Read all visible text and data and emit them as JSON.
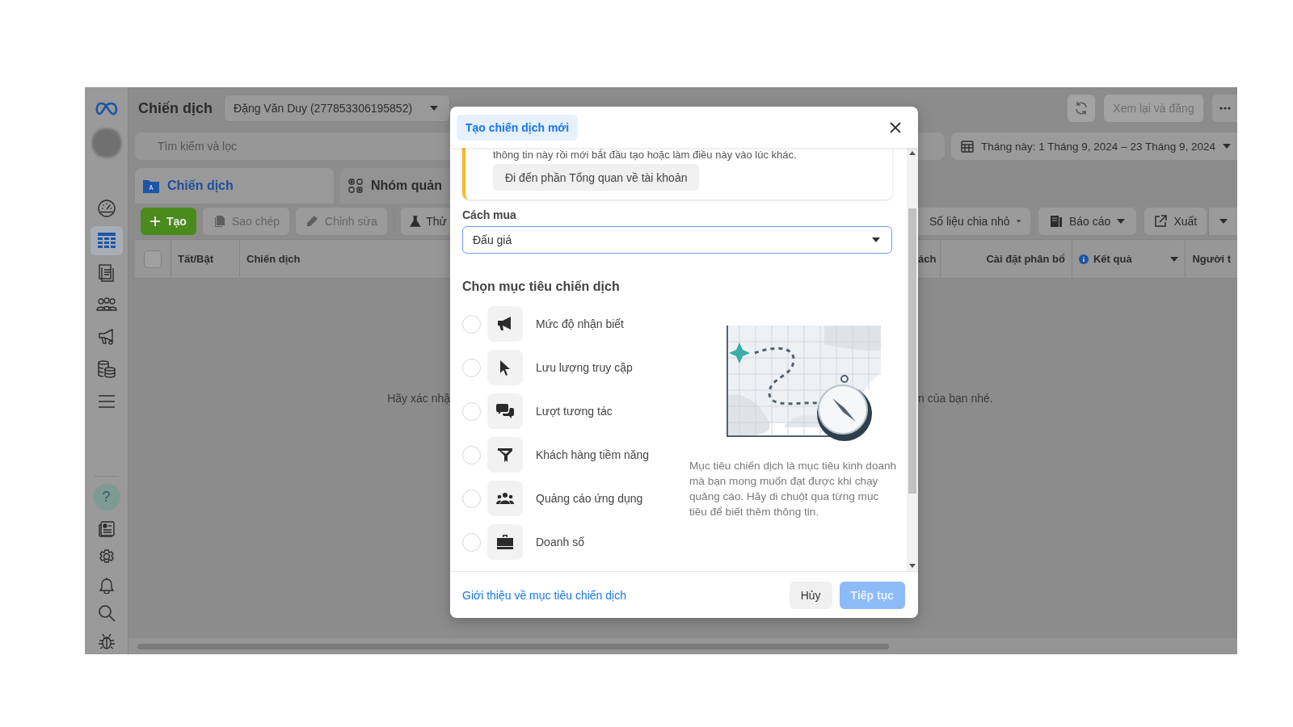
{
  "sidebar": {
    "items": [
      {
        "selected": false
      },
      {
        "selected": true
      },
      {
        "selected": false
      },
      {
        "selected": false
      },
      {
        "selected": false
      },
      {
        "selected": false
      },
      {
        "selected": false
      }
    ],
    "help_button": "?"
  },
  "header": {
    "title": "Chiến dịch",
    "account": "Đặng Văn Duy (277853306195852)",
    "review_button": {
      "label": "Xem lại và đăng",
      "disabled": true
    }
  },
  "search": {
    "placeholder": "Tìm kiếm và lọc"
  },
  "date_range": "Tháng này: 1 Tháng 9, 2024 – 23 Tháng 9, 2024",
  "tabs": [
    {
      "label": "Chiến dịch",
      "selected": true
    },
    {
      "label": "Nhóm quản",
      "selected": false
    }
  ],
  "toolbar": {
    "left": [
      {
        "label": "Tạo",
        "kind": "primary",
        "disabled": false
      },
      {
        "label": "Sao chép",
        "kind": "plain",
        "disabled": true
      },
      {
        "label": "Chỉnh sửa",
        "kind": "plain",
        "disabled": true
      },
      {
        "label": "Thử",
        "kind": "plain",
        "disabled": false
      }
    ],
    "right": [
      {
        "label": "Số liệu chia nhỏ",
        "kind": "dropdown",
        "disabled": false
      },
      {
        "label": "Báo cáo",
        "kind": "dropdown",
        "disabled": false
      },
      {
        "label": "Xuất",
        "kind": "plain",
        "disabled": false
      }
    ]
  },
  "table": {
    "select_all": {
      "checked": false
    },
    "columns_left": [
      "Tất/Bật",
      "Chiến dịch"
    ],
    "columns_right": [
      "ách",
      "Cài đặt phân bổ",
      "Kết quả",
      "Người t"
    ],
    "empty_message_left": "Hãy xác nhậ",
    "empty_message_right": "n của bạn nhé."
  },
  "modal": {
    "tab": "Tạo chiến dịch mới",
    "notice": {
      "text": "thông tin này rồi mới bắt đầu tạo hoặc làm điều này vào lúc khác.",
      "button": "Đi đến phần Tổng quan về tài khoản"
    },
    "buying_type": {
      "label": "Cách mua",
      "value": "Đấu giá"
    },
    "objectives_title": "Chọn mục tiêu chiến dịch",
    "objectives": [
      {
        "label": "Mức độ nhận biết",
        "selected": false
      },
      {
        "label": "Lưu lượng truy cập",
        "selected": false
      },
      {
        "label": "Lượt tương tác",
        "selected": false
      },
      {
        "label": "Khách hàng tiềm năng",
        "selected": false
      },
      {
        "label": "Quảng cáo ứng dụng",
        "selected": false
      },
      {
        "label": "Doanh số",
        "selected": false
      }
    ],
    "description": "Mục tiêu chiến dịch là mục tiêu kinh doanh mà bạn mong muốn đạt được khi chạy quảng cáo. Hãy di chuột qua từng mục tiêu để biết thêm thông tin.",
    "footer": {
      "link": "Giới thiệu về mục tiêu chiến dịch",
      "cancel": "Hủy",
      "continue": {
        "label": "Tiếp tục",
        "disabled": true
      }
    }
  }
}
